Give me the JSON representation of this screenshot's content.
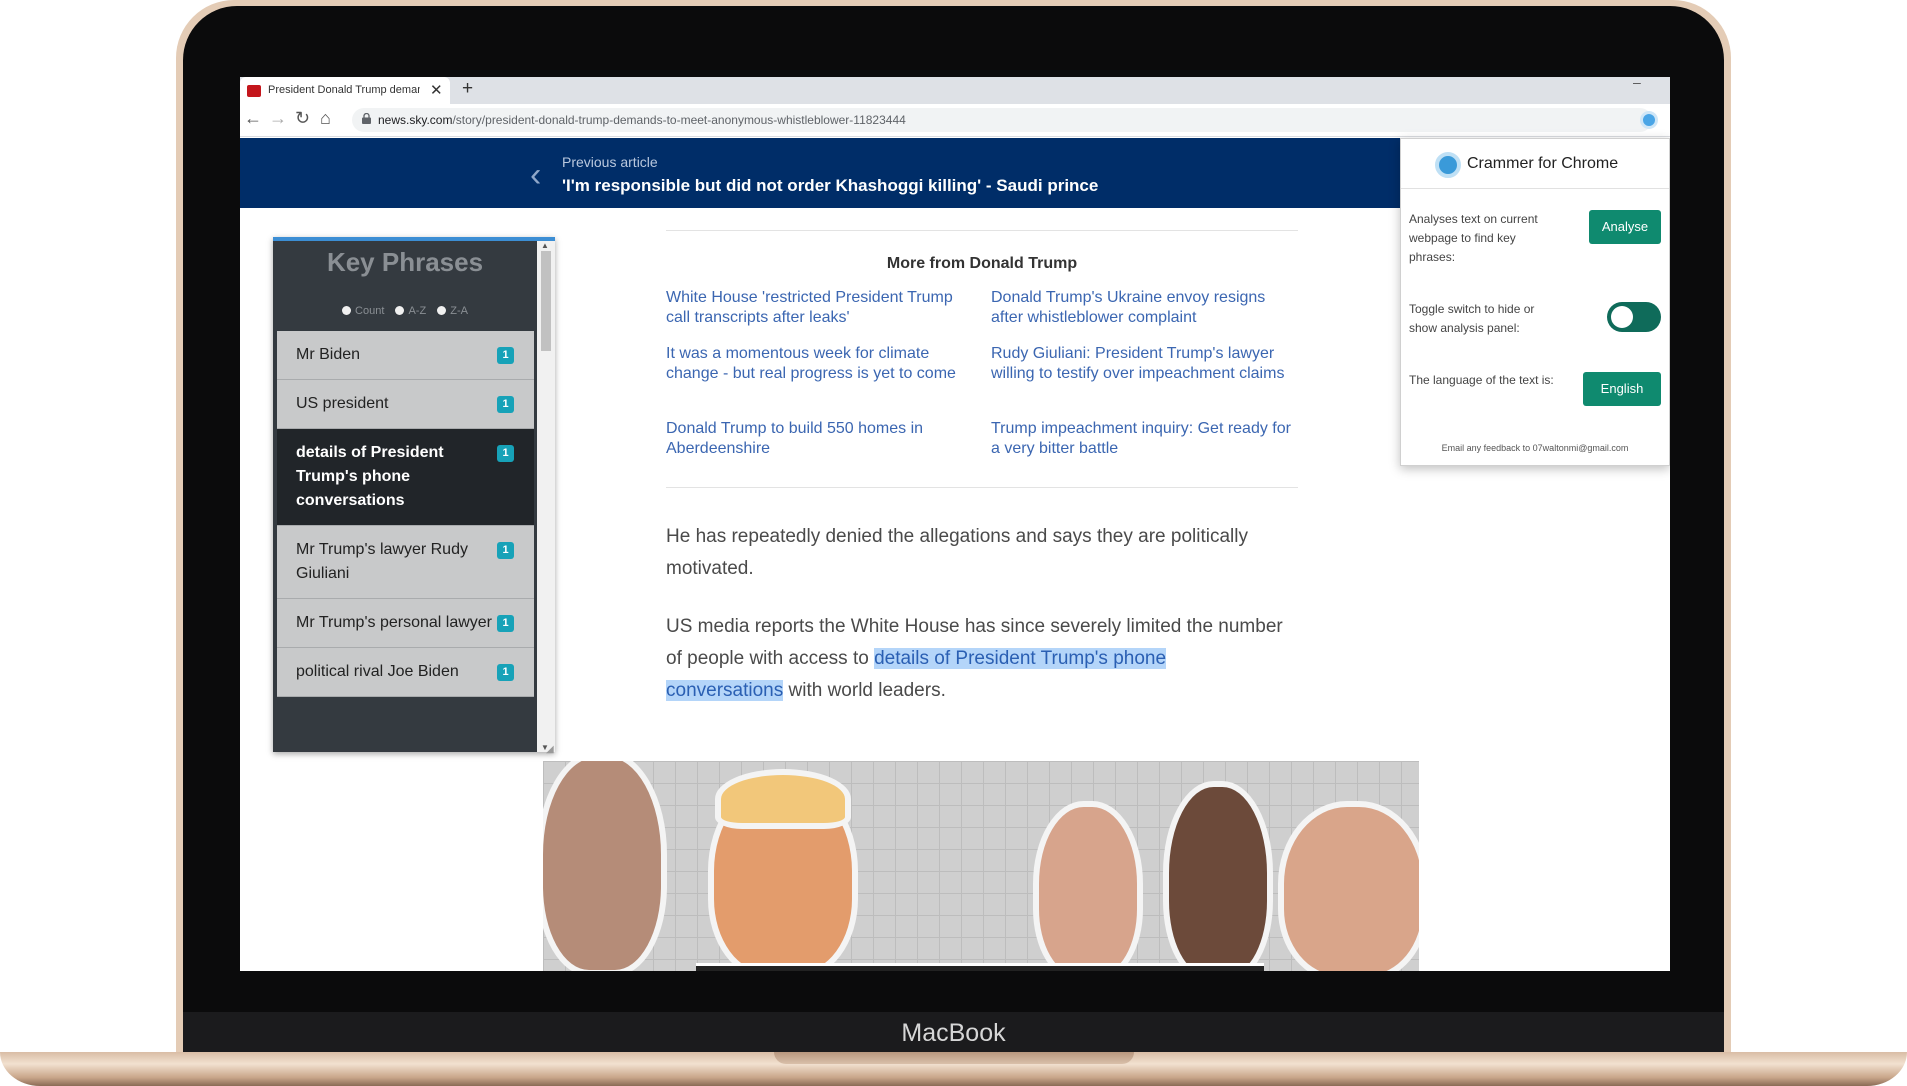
{
  "device": {
    "brand": "MacBook"
  },
  "browser": {
    "tab_title": "President Donald Trump demand",
    "tab_close": "✕",
    "new_tab": "+",
    "url_host": "news.sky.com",
    "url_path": "/story/president-donald-trump-demands-to-meet-anonymous-whistleblower-11823444"
  },
  "banner": {
    "label": "Previous article",
    "title": "'I'm responsible but did not order Khashoggi killing' - Saudi prince"
  },
  "key_phrases": {
    "title": "Key Phrases",
    "sort_options": [
      "Count",
      "A-Z",
      "Z-A"
    ],
    "items": [
      {
        "label": "Mr Biden",
        "count": "1",
        "active": false
      },
      {
        "label": "US president",
        "count": "1",
        "active": false
      },
      {
        "label": "details of President Trump's phone conversations",
        "count": "1",
        "active": true
      },
      {
        "label": "Mr Trump's lawyer Rudy Giuliani",
        "count": "1",
        "active": false
      },
      {
        "label": "Mr Trump's personal lawyer",
        "count": "1",
        "active": false
      },
      {
        "label": "political rival Joe Biden",
        "count": "1",
        "active": false
      }
    ]
  },
  "more_from": {
    "heading": "More from Donald Trump",
    "links": [
      "White House 'restricted President Trump call transcripts after leaks'",
      "Donald Trump's Ukraine envoy resigns after whistleblower complaint",
      "It was a momentous week for climate change - but real progress is yet to come",
      "Rudy Giuliani: President Trump's lawyer willing to testify over impeachment claims",
      "Donald Trump to build 550 homes in Aberdeenshire",
      "Trump impeachment inquiry: Get ready for a very bitter battle"
    ]
  },
  "article": {
    "p1": "He has repeatedly denied the allegations and says they are politically motivated.",
    "p2_before": "US media reports the White House has since severely limited the number of people with access to ",
    "p2_highlight": "details of President Trump's phone conversations",
    "p2_after": " with world leaders."
  },
  "extension": {
    "title": "Crammer for Chrome",
    "analyse_text": "Analyses text on current webpage to find key phrases:",
    "analyse_button": "Analyse",
    "toggle_text": "Toggle switch to hide or show analysis panel:",
    "toggle_on": true,
    "language_text": "The language of the text is:",
    "language_button": "English",
    "footer": "Email any feedback to 07waltonmi@gmail.com"
  },
  "colors": {
    "banner": "#002d68",
    "link": "#3b66b1",
    "highlight": "#b4d5f9",
    "badge": "#17a2b8",
    "button": "#0f8a6f"
  }
}
